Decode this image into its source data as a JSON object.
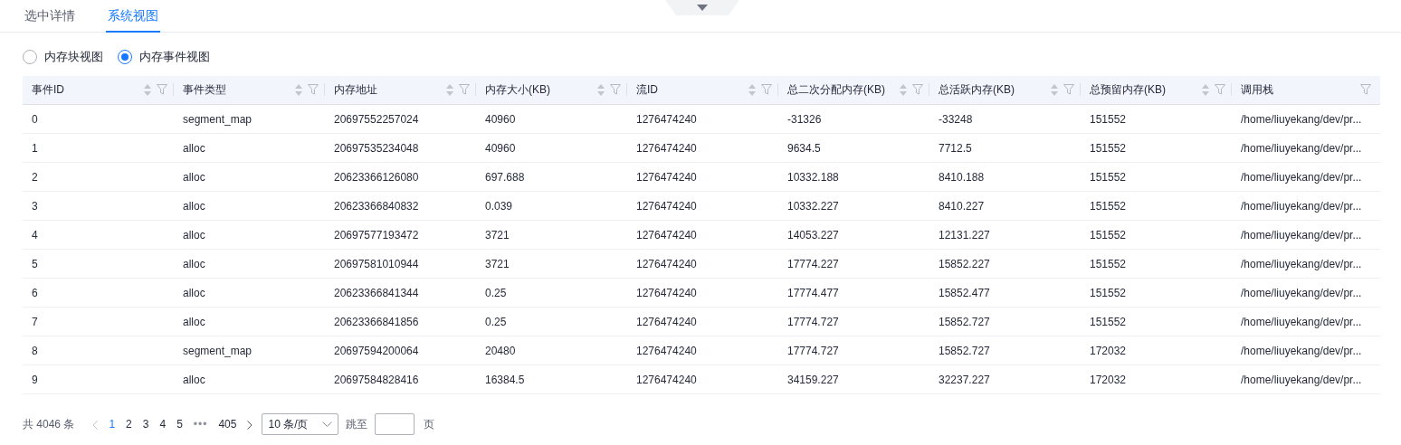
{
  "tabs": [
    {
      "label": "选中详情",
      "selected": false
    },
    {
      "label": "系统视图",
      "selected": true
    }
  ],
  "view_options": [
    {
      "label": "内存块视图",
      "selected": false
    },
    {
      "label": "内存事件视图",
      "selected": true
    }
  ],
  "table": {
    "columns": [
      {
        "label": "事件ID",
        "sortable": true,
        "filterable": true
      },
      {
        "label": "事件类型",
        "sortable": true,
        "filterable": true
      },
      {
        "label": "内存地址",
        "sortable": true,
        "filterable": true
      },
      {
        "label": "内存大小(KB)",
        "sortable": true,
        "filterable": true
      },
      {
        "label": "流ID",
        "sortable": true,
        "filterable": true
      },
      {
        "label": "总二次分配内存(KB)",
        "sortable": true,
        "filterable": true
      },
      {
        "label": "总活跃内存(KB)",
        "sortable": true,
        "filterable": true
      },
      {
        "label": "总预留内存(KB)",
        "sortable": true,
        "filterable": true
      },
      {
        "label": "调用栈",
        "sortable": false,
        "filterable": true
      }
    ],
    "rows": [
      [
        "0",
        "segment_map",
        "20697552257024",
        "40960",
        "1276474240",
        "-31326",
        "-33248",
        "151552",
        "/home/liuyekang/dev/pr..."
      ],
      [
        "1",
        "alloc",
        "20697535234048",
        "40960",
        "1276474240",
        "9634.5",
        "7712.5",
        "151552",
        "/home/liuyekang/dev/pr..."
      ],
      [
        "2",
        "alloc",
        "20623366126080",
        "697.688",
        "1276474240",
        "10332.188",
        "8410.188",
        "151552",
        "/home/liuyekang/dev/pr..."
      ],
      [
        "3",
        "alloc",
        "20623366840832",
        "0.039",
        "1276474240",
        "10332.227",
        "8410.227",
        "151552",
        "/home/liuyekang/dev/pr..."
      ],
      [
        "4",
        "alloc",
        "20697577193472",
        "3721",
        "1276474240",
        "14053.227",
        "12131.227",
        "151552",
        "/home/liuyekang/dev/pr..."
      ],
      [
        "5",
        "alloc",
        "20697581010944",
        "3721",
        "1276474240",
        "17774.227",
        "15852.227",
        "151552",
        "/home/liuyekang/dev/pr..."
      ],
      [
        "6",
        "alloc",
        "20623366841344",
        "0.25",
        "1276474240",
        "17774.477",
        "15852.477",
        "151552",
        "/home/liuyekang/dev/pr..."
      ],
      [
        "7",
        "alloc",
        "20623366841856",
        "0.25",
        "1276474240",
        "17774.727",
        "15852.727",
        "151552",
        "/home/liuyekang/dev/pr..."
      ],
      [
        "8",
        "segment_map",
        "20697594200064",
        "20480",
        "1276474240",
        "17774.727",
        "15852.727",
        "172032",
        "/home/liuyekang/dev/pr..."
      ],
      [
        "9",
        "alloc",
        "20697584828416",
        "16384.5",
        "1276474240",
        "34159.227",
        "32237.227",
        "172032",
        "/home/liuyekang/dev/pr..."
      ]
    ]
  },
  "pagination": {
    "total": "共 4046 条",
    "pages": [
      {
        "label": "1",
        "selected": true
      },
      {
        "label": "2",
        "selected": false
      },
      {
        "label": "3",
        "selected": false
      },
      {
        "label": "4",
        "selected": false
      },
      {
        "label": "5",
        "selected": false
      },
      {
        "label": "•••",
        "kind": "ellipsis"
      },
      {
        "label": "405",
        "selected": false
      }
    ],
    "page_size": "10 条/页",
    "jump_label": "跳至",
    "page_unit": "页"
  }
}
